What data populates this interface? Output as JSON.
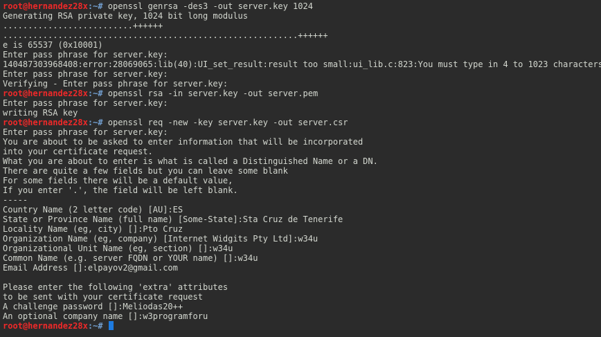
{
  "terminal": {
    "lines": [
      {
        "type": "prompt",
        "user": "root@hernandez28x",
        "path": ":~#",
        "cmd": " openssl genrsa -des3 -out server.key 1024"
      },
      {
        "type": "text",
        "text": "Generating RSA private key, 1024 bit long modulus"
      },
      {
        "type": "text",
        "text": "..........................++++++"
      },
      {
        "type": "text",
        "text": "...........................................................++++++"
      },
      {
        "type": "text",
        "text": "e is 65537 (0x10001)"
      },
      {
        "type": "text",
        "text": "Enter pass phrase for server.key:"
      },
      {
        "type": "text",
        "text": "140487303968408:error:28069065:lib(40):UI_set_result:result too small:ui_lib.c:823:You must type in 4 to 1023 characters"
      },
      {
        "type": "text",
        "text": "Enter pass phrase for server.key:"
      },
      {
        "type": "text",
        "text": "Verifying - Enter pass phrase for server.key:"
      },
      {
        "type": "prompt",
        "user": "root@hernandez28x",
        "path": ":~#",
        "cmd": " openssl rsa -in server.key -out server.pem"
      },
      {
        "type": "text",
        "text": "Enter pass phrase for server.key:"
      },
      {
        "type": "text",
        "text": "writing RSA key"
      },
      {
        "type": "prompt",
        "user": "root@hernandez28x",
        "path": ":~#",
        "cmd": " openssl req -new -key server.key -out server.csr"
      },
      {
        "type": "text",
        "text": "Enter pass phrase for server.key:"
      },
      {
        "type": "text",
        "text": "You are about to be asked to enter information that will be incorporated"
      },
      {
        "type": "text",
        "text": "into your certificate request."
      },
      {
        "type": "text",
        "text": "What you are about to enter is what is called a Distinguished Name or a DN."
      },
      {
        "type": "text",
        "text": "There are quite a few fields but you can leave some blank"
      },
      {
        "type": "text",
        "text": "For some fields there will be a default value,"
      },
      {
        "type": "text",
        "text": "If you enter '.', the field will be left blank."
      },
      {
        "type": "text",
        "text": "-----"
      },
      {
        "type": "text",
        "text": "Country Name (2 letter code) [AU]:ES"
      },
      {
        "type": "text",
        "text": "State or Province Name (full name) [Some-State]:Sta Cruz de Tenerife"
      },
      {
        "type": "text",
        "text": "Locality Name (eg, city) []:Pto Cruz"
      },
      {
        "type": "text",
        "text": "Organization Name (eg, company) [Internet Widgits Pty Ltd]:w34u"
      },
      {
        "type": "text",
        "text": "Organizational Unit Name (eg, section) []:w34u"
      },
      {
        "type": "text",
        "text": "Common Name (e.g. server FQDN or YOUR name) []:w34u"
      },
      {
        "type": "text",
        "text": "Email Address []:elpayov2@gmail.com"
      },
      {
        "type": "text",
        "text": ""
      },
      {
        "type": "text",
        "text": "Please enter the following 'extra' attributes"
      },
      {
        "type": "text",
        "text": "to be sent with your certificate request"
      },
      {
        "type": "text",
        "text": "A challenge password []:Meliodas20++"
      },
      {
        "type": "text",
        "text": "An optional company name []:w3programforu"
      },
      {
        "type": "prompt",
        "user": "root@hernandez28x",
        "path": ":~#",
        "cmd": " ",
        "cursor": true
      }
    ]
  },
  "colors": {
    "background": "#2b2b2b",
    "text": "#d3d7cf",
    "prompt_user": "#ef2929",
    "prompt_path": "#729fcf",
    "cursor": "#1e7be0"
  }
}
